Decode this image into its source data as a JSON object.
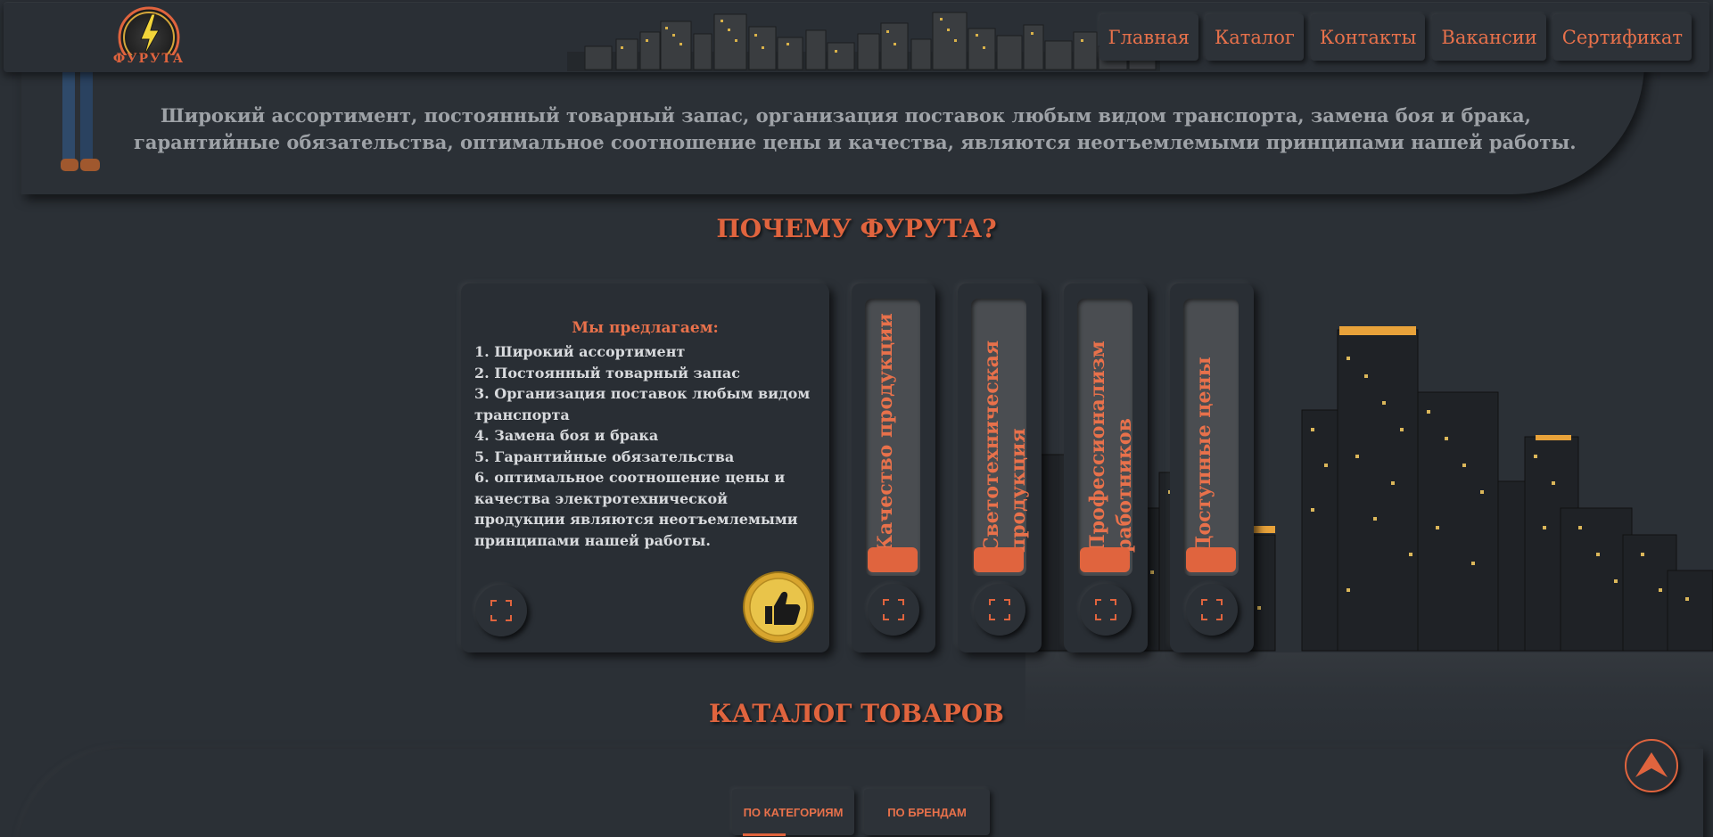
{
  "header": {
    "logo_text": "ФУРУТА",
    "nav": [
      {
        "label": "Главная"
      },
      {
        "label": "Каталог"
      },
      {
        "label": "Контакты"
      },
      {
        "label": "Вакансии"
      },
      {
        "label": "Сертификат"
      }
    ]
  },
  "about": {
    "text": "Широкий ассортимент, постоянный товарный запас, организация поставок любым видом транспорта, замена боя и брака, гарантийные обязательства, оптимальное соотношение цены и качества, являются неотъемлемыми принципами нашей работы."
  },
  "why": {
    "title": "ПОЧЕМУ ФУРУТА?",
    "offer_title": "Мы предлагаем:",
    "offer_items": [
      "1. Широкий ассортимент",
      "2. Постоянный товарный запас",
      "3. Организация поставок любым видом транспорта",
      "4. Замена боя и брака",
      "5. Гарантийные обязательства",
      "6. оптимальное соотношение цены и качества электротехнической продукции являются неотъемлемыми принципами нашей работы."
    ],
    "cards": [
      {
        "label": "Качество продукции"
      },
      {
        "label": "Светотехническая продукция"
      },
      {
        "label": "Профессионализм работников"
      },
      {
        "label": "Доступные цены"
      }
    ]
  },
  "catalog": {
    "title": "КАТАЛОГ ТОВАРОВ",
    "tabs": [
      {
        "label": "ПО КАТЕГОРИЯМ"
      },
      {
        "label": "ПО БРЕНДАМ"
      }
    ]
  },
  "colors": {
    "accent": "#e0643e",
    "background": "#2b3036",
    "card": "#292e34"
  },
  "icons": [
    "lightning-logo-icon",
    "expand-icon",
    "thumbs-up-icon",
    "scroll-top-arrow-icon"
  ]
}
